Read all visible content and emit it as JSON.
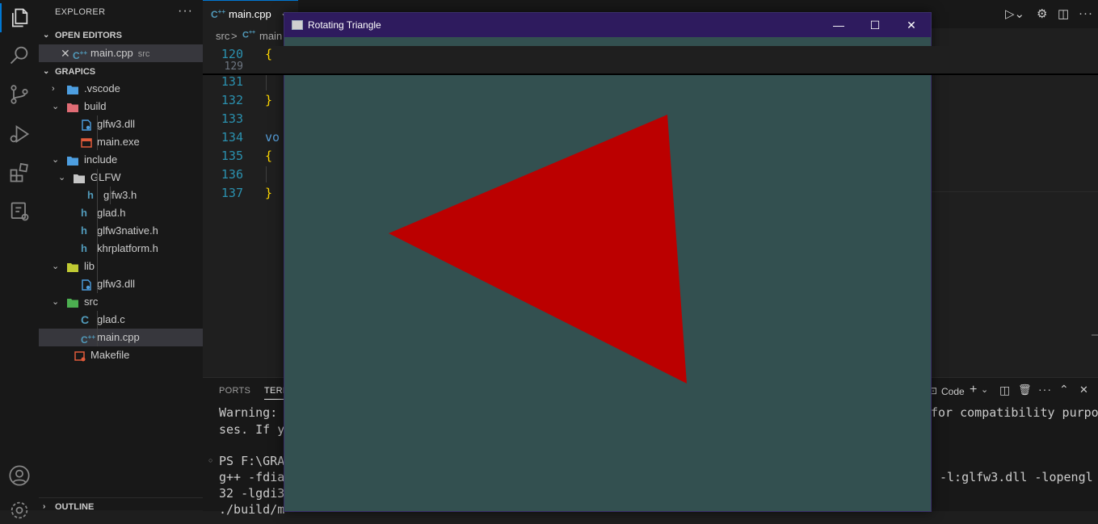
{
  "explorer": {
    "title": "EXPLORER",
    "more": "···",
    "open_editors": {
      "label": "OPEN EDITORS",
      "items": [
        {
          "name": "main.cpp",
          "desc": "src",
          "icon": "cpp-file-icon"
        }
      ]
    },
    "workspace": {
      "label": "GRAPICS",
      "tree": [
        {
          "name": ".vscode",
          "type": "folder",
          "depth": 0,
          "expanded": false,
          "icon": "vscode-folder-icon",
          "color": "#4d9ee0"
        },
        {
          "name": "build",
          "type": "folder",
          "depth": 0,
          "expanded": true,
          "icon": "build-folder-icon",
          "color": "#e06c75"
        },
        {
          "name": "glfw3.dll",
          "type": "file",
          "depth": 1,
          "icon": "dll-file-icon",
          "color": "#4d9ee0"
        },
        {
          "name": "main.exe",
          "type": "file",
          "depth": 1,
          "icon": "exe-file-icon",
          "color": "#e05a3a"
        },
        {
          "name": "include",
          "type": "folder",
          "depth": 0,
          "expanded": true,
          "icon": "include-folder-icon",
          "color": "#4d9ee0"
        },
        {
          "name": "GLFW",
          "type": "folder",
          "depth": 1,
          "expanded": true,
          "icon": "folder-icon",
          "color": "#c5c5c5"
        },
        {
          "name": "glfw3.h",
          "type": "file",
          "depth": 2,
          "icon": "header-file-icon",
          "color": "#519aba"
        },
        {
          "name": "glad.h",
          "type": "file",
          "depth": 1,
          "icon": "header-file-icon",
          "color": "#519aba"
        },
        {
          "name": "glfw3native.h",
          "type": "file",
          "depth": 1,
          "icon": "header-file-icon",
          "color": "#519aba"
        },
        {
          "name": "khrplatform.h",
          "type": "file",
          "depth": 1,
          "icon": "header-file-icon",
          "color": "#519aba"
        },
        {
          "name": "lib",
          "type": "folder",
          "depth": 0,
          "expanded": true,
          "icon": "lib-folder-icon",
          "color": "#c0ca33"
        },
        {
          "name": "glfw3.dll",
          "type": "file",
          "depth": 1,
          "icon": "dll-file-icon",
          "color": "#4d9ee0"
        },
        {
          "name": "src",
          "type": "folder",
          "depth": 0,
          "expanded": true,
          "icon": "src-folder-icon",
          "color": "#4caf50"
        },
        {
          "name": "glad.c",
          "type": "file",
          "depth": 1,
          "icon": "c-file-icon",
          "color": "#519aba"
        },
        {
          "name": "main.cpp",
          "type": "file",
          "depth": 1,
          "icon": "cpp-file-icon",
          "color": "#519aba",
          "selected": true
        },
        {
          "name": "Makefile",
          "type": "file",
          "depth": 0,
          "icon": "makefile-icon",
          "color": "#e05a3a"
        }
      ]
    },
    "outline_label": "OUTLINE"
  },
  "editor": {
    "tab": {
      "label": "main.cpp",
      "icon": "cpp-file-icon"
    },
    "breadcrumb": {
      "folder": "src",
      "sep": ">",
      "file": "main"
    },
    "sticky_line": {
      "number": "120",
      "text": "{"
    },
    "sticky_partial_number": "129",
    "lines": [
      {
        "number": "131",
        "text": "",
        "color": "#cccccc"
      },
      {
        "number": "132",
        "text": "}",
        "color": "#ffd700"
      },
      {
        "number": "133",
        "text": "",
        "color": "#cccccc"
      },
      {
        "number": "134",
        "text": "vo",
        "color": "#569cd6"
      },
      {
        "number": "135",
        "text": "{",
        "color": "#ffd700"
      },
      {
        "number": "136",
        "text": "",
        "color": "#cccccc"
      },
      {
        "number": "137",
        "text": "}",
        "color": "#ffd700"
      }
    ]
  },
  "panel": {
    "tabs": [
      {
        "label": "PORTS"
      },
      {
        "label": "TERM"
      }
    ],
    "terminal_profile": "Code",
    "terminal_lines_left": [
      "Warning: ",
      "ses. If y",
      "",
      "PS F:\\GRA",
      "g++ -fdia",
      "32 -lgdi3",
      "./build/m"
    ],
    "terminal_lines_right": [
      "for compatibility purpo",
      "",
      "",
      "",
      "-l:glfw3.dll -lopengl",
      "",
      ""
    ]
  },
  "gl_window": {
    "title": "Rotating Triangle",
    "background": "#335050",
    "triangle_color": "#bb0000",
    "minimize": "—",
    "maximize": "☐",
    "close": "✕"
  }
}
